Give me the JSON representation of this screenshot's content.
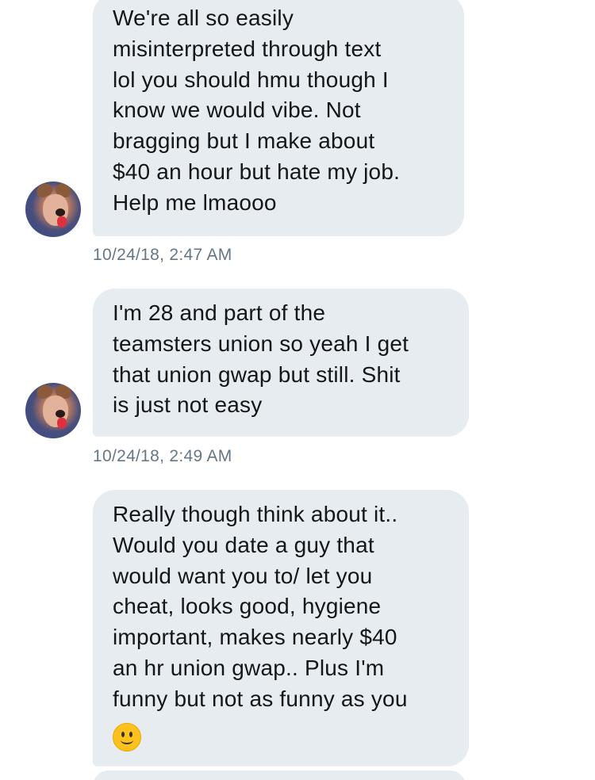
{
  "conversation": {
    "messages": [
      {
        "text": "We're all so easily\nmisinterpreted through text\nlol you should hmu though I\nknow we would vibe. Not\nbragging but I make about\n$40 an hour but hate my job.\nHelp me lmaooo",
        "timestamp": "10/24/18, 2:47 AM"
      },
      {
        "text": "I'm 28 and part of the\nteamsters union so yeah I get\nthat union gwap but still. Shit\nis just not easy",
        "timestamp": "10/24/18, 2:49 AM"
      },
      {
        "text": "Really though think about it..\nWould you date a guy that\nwould want you to/ let you\ncheat, looks good, hygiene\nimportant, makes nearly $40\nan hr union gwap.. Plus I'm\nfunny but not as funny as you",
        "emoji": "slightly-smiling-face-icon"
      }
    ]
  },
  "colors": {
    "bubble_background": "#e6ecf0",
    "message_text": "#14171a",
    "timestamp_text": "#657786",
    "page_background": "#ffffff"
  }
}
